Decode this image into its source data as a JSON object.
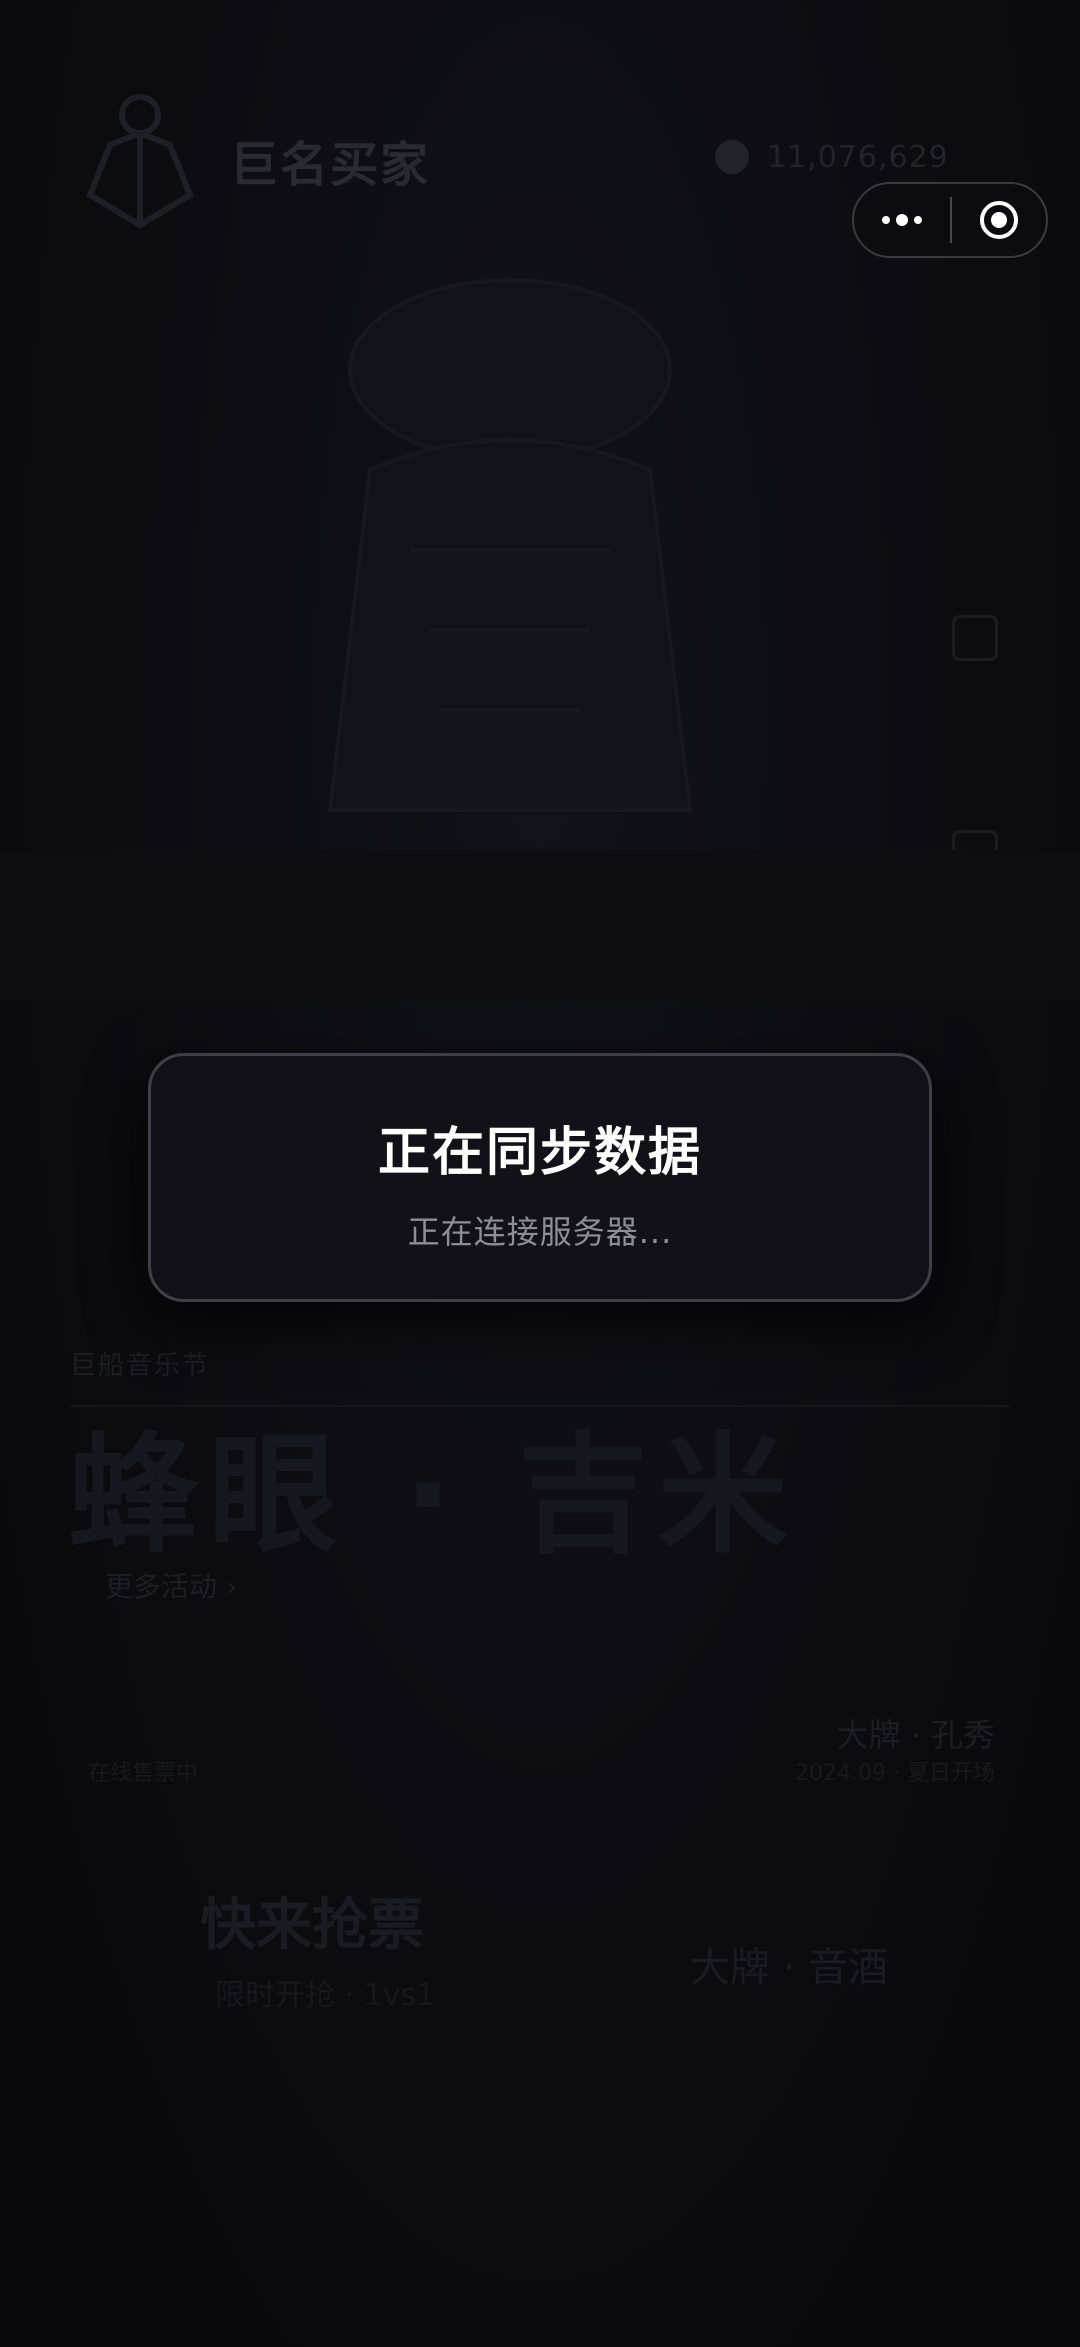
{
  "background": {
    "app_name": "巨名买家",
    "balance": "11,076,629",
    "event_subtitle": "巨船音乐节",
    "event_title": "蜂眼 · 吉米",
    "event_more": "更多活动 ›",
    "time_title": "大牌 · 孔秀",
    "time_sub": "2024.09 · 夏日开场",
    "ticket_label": "在线售票中",
    "chip_left_title": "快来抢票",
    "chip_left_sub": "限时开抢 · 1vs1",
    "chip_right": "大牌 · 音酒"
  },
  "capsule": {
    "more_icon": "more-dots-icon",
    "close_icon": "close-ring-icon"
  },
  "dialog": {
    "title": "正在同步数据",
    "message": "正在连接服务器..."
  },
  "colors": {
    "background": "#0b0b10",
    "dialog_bg": "#111117",
    "dialog_border": "#3f3f47",
    "title": "#ffffff",
    "message": "#8e8e96"
  }
}
